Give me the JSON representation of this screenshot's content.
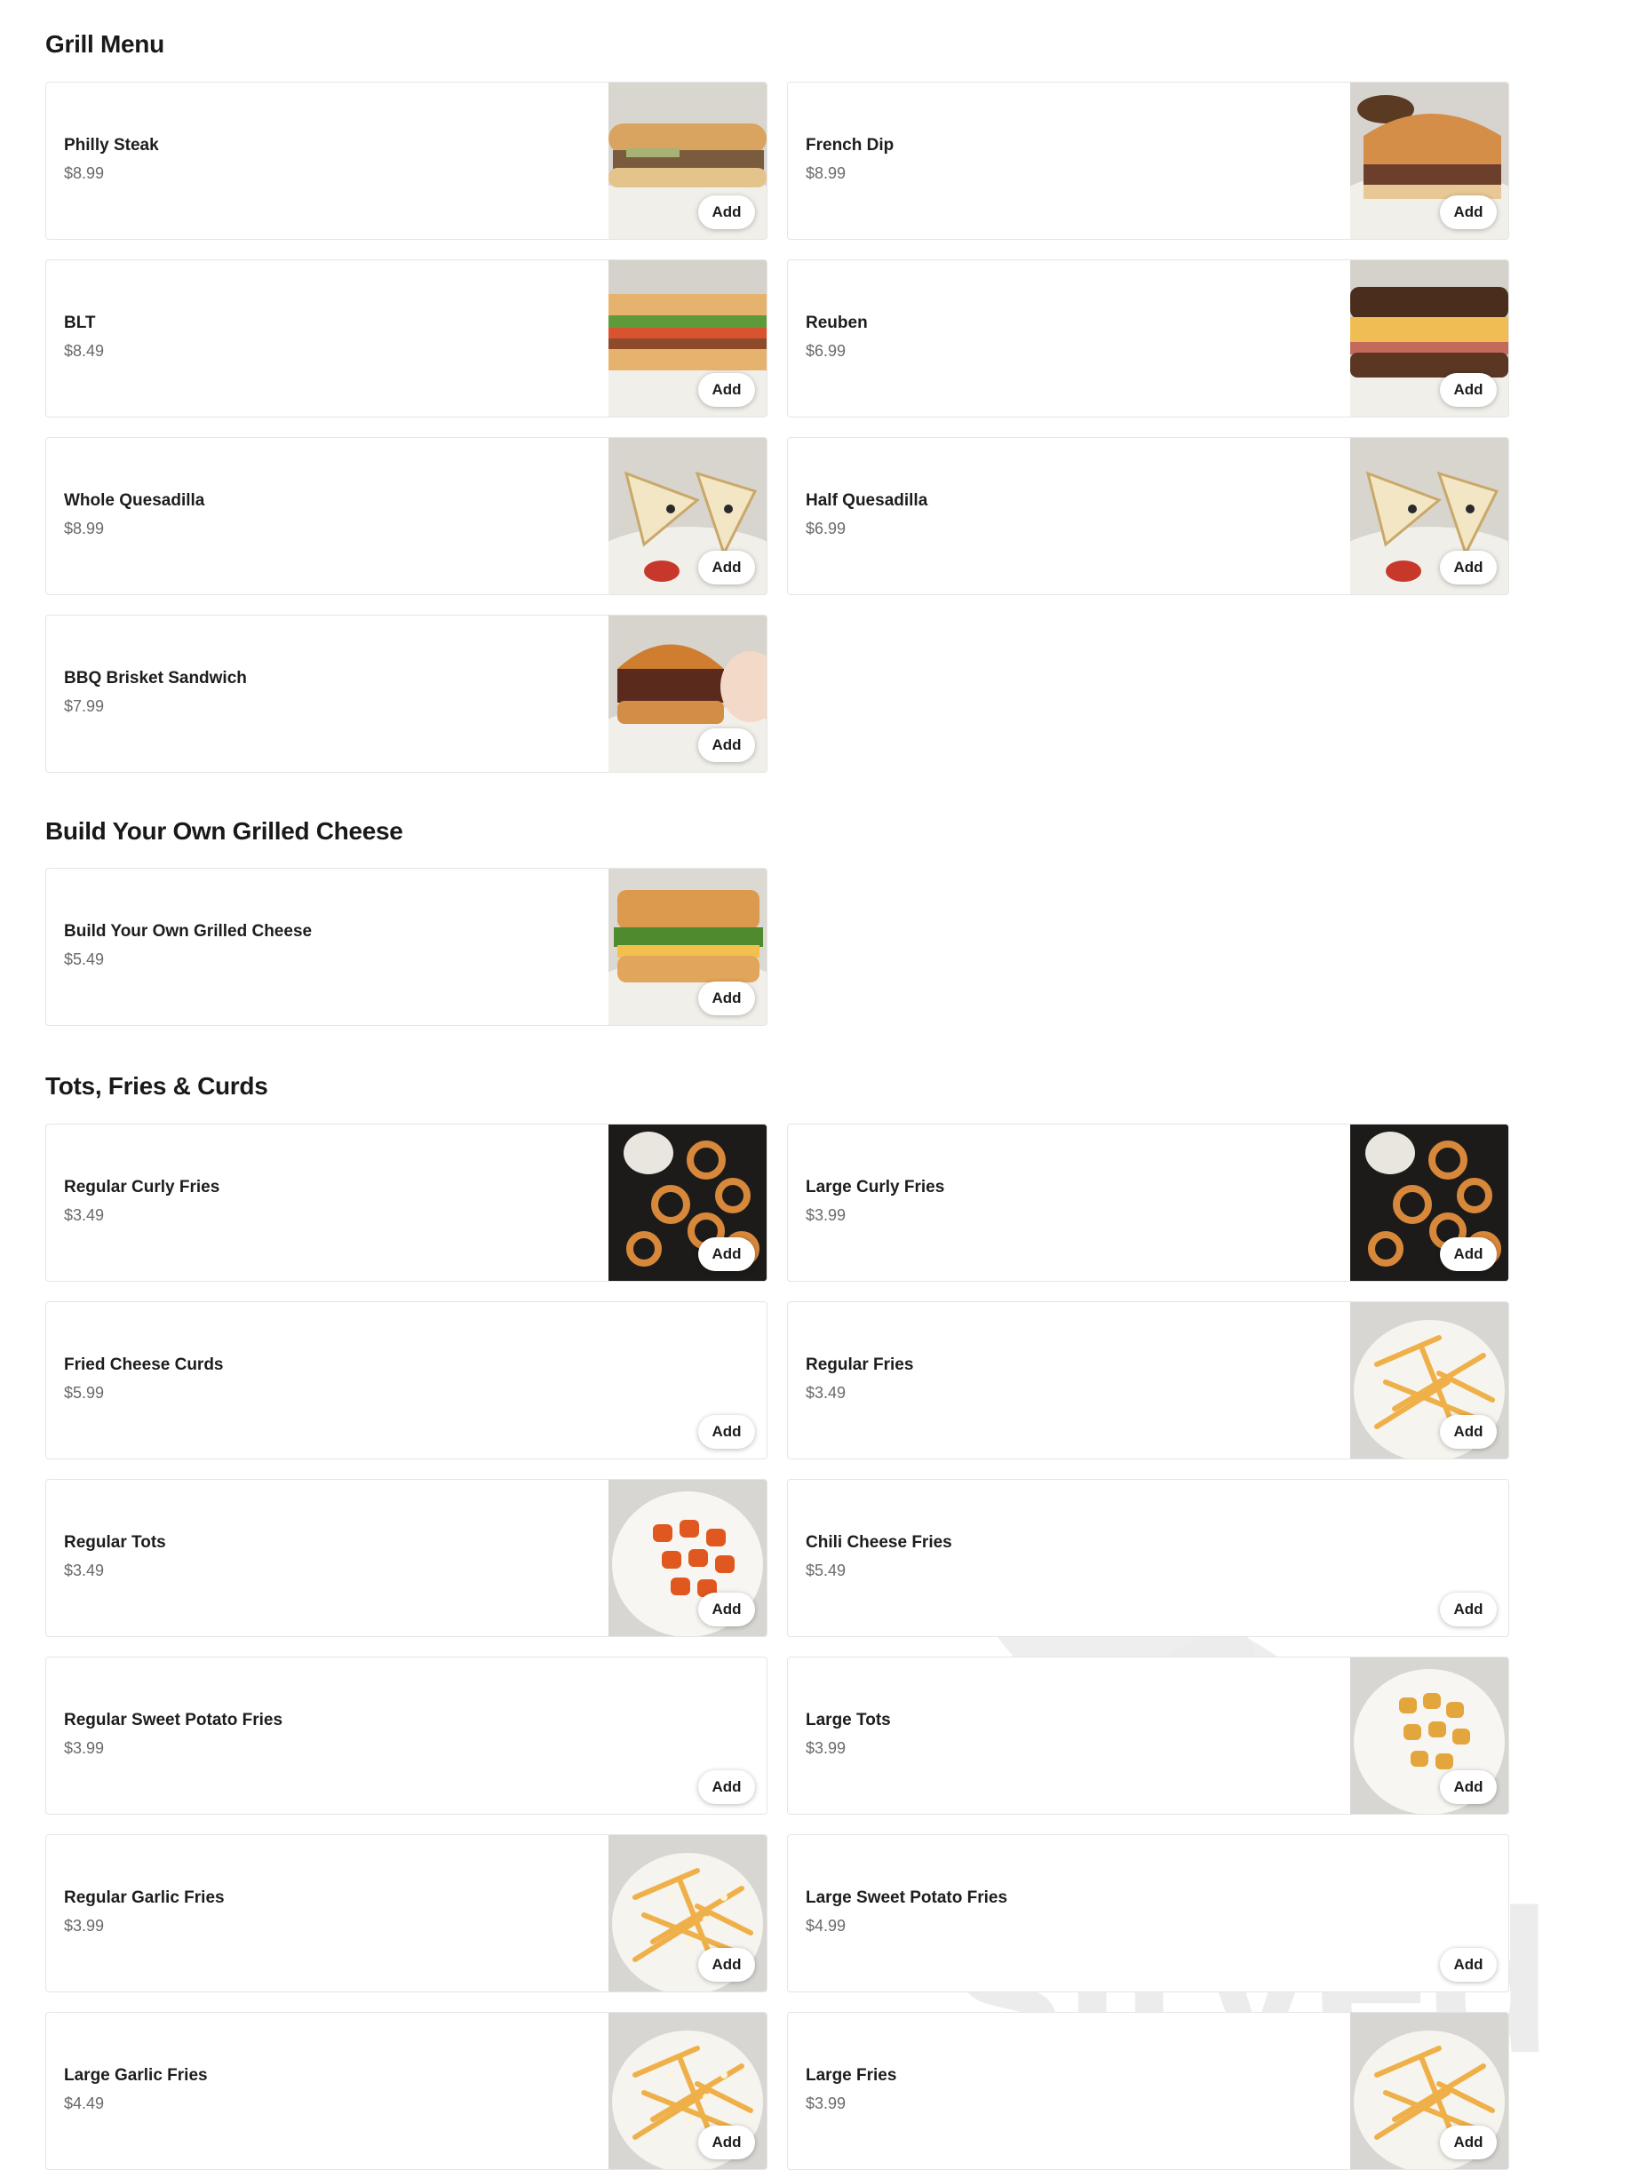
{
  "sections": {
    "grill": {
      "title": "Grill Menu",
      "items": [
        {
          "name": "Philly Steak",
          "price": "$8.99",
          "add": "Add",
          "image": "philly-steak-photo"
        },
        {
          "name": "French Dip",
          "price": "$8.99",
          "add": "Add",
          "image": "french-dip-photo"
        },
        {
          "name": "BLT",
          "price": "$8.49",
          "add": "Add",
          "image": "blt-photo"
        },
        {
          "name": "Reuben",
          "price": "$6.99",
          "add": "Add",
          "image": "reuben-photo"
        },
        {
          "name": "Whole Quesadilla",
          "price": "$8.99",
          "add": "Add",
          "image": "quesadilla-photo"
        },
        {
          "name": "Half Quesadilla",
          "price": "$6.99",
          "add": "Add",
          "image": "quesadilla-photo"
        },
        {
          "name": "BBQ Brisket Sandwich",
          "price": "$7.99",
          "add": "Add",
          "image": "brisket-photo"
        }
      ]
    },
    "grilled_cheese": {
      "title": "Build Your Own Grilled Cheese",
      "items": [
        {
          "name": "Build Your Own Grilled Cheese",
          "price": "$5.49",
          "add": "Add",
          "image": "grilled-cheese-photo"
        }
      ]
    },
    "sides": {
      "title": "Tots, Fries & Curds",
      "items": [
        {
          "name": "Regular Curly Fries",
          "price": "$3.49",
          "add": "Add",
          "image": "curly-fries-photo"
        },
        {
          "name": "Large Curly Fries",
          "price": "$3.99",
          "add": "Add",
          "image": "curly-fries-photo"
        },
        {
          "name": "Fried Cheese Curds",
          "price": "$5.99",
          "add": "Add"
        },
        {
          "name": "Regular Fries",
          "price": "$3.49",
          "add": "Add",
          "image": "fries-photo"
        },
        {
          "name": "Regular Tots",
          "price": "$3.49",
          "add": "Add",
          "image": "buffalo-tots-photo"
        },
        {
          "name": "Chili Cheese Fries",
          "price": "$5.49",
          "add": "Add"
        },
        {
          "name": "Regular Sweet Potato Fries",
          "price": "$3.99",
          "add": "Add"
        },
        {
          "name": "Large Tots",
          "price": "$3.99",
          "add": "Add",
          "image": "tots-photo"
        },
        {
          "name": "Regular Garlic Fries",
          "price": "$3.99",
          "add": "Add",
          "image": "garlic-fries-photo"
        },
        {
          "name": "Large Sweet Potato Fries",
          "price": "$4.99",
          "add": "Add"
        },
        {
          "name": "Large Garlic Fries",
          "price": "$4.49",
          "add": "Add",
          "image": "garlic-fries-photo"
        },
        {
          "name": "Large Fries",
          "price": "$3.99",
          "add": "Add",
          "image": "fries-photo"
        }
      ]
    }
  },
  "watermark": {
    "text": "sirved",
    "icon": "fork-plate-icon"
  }
}
